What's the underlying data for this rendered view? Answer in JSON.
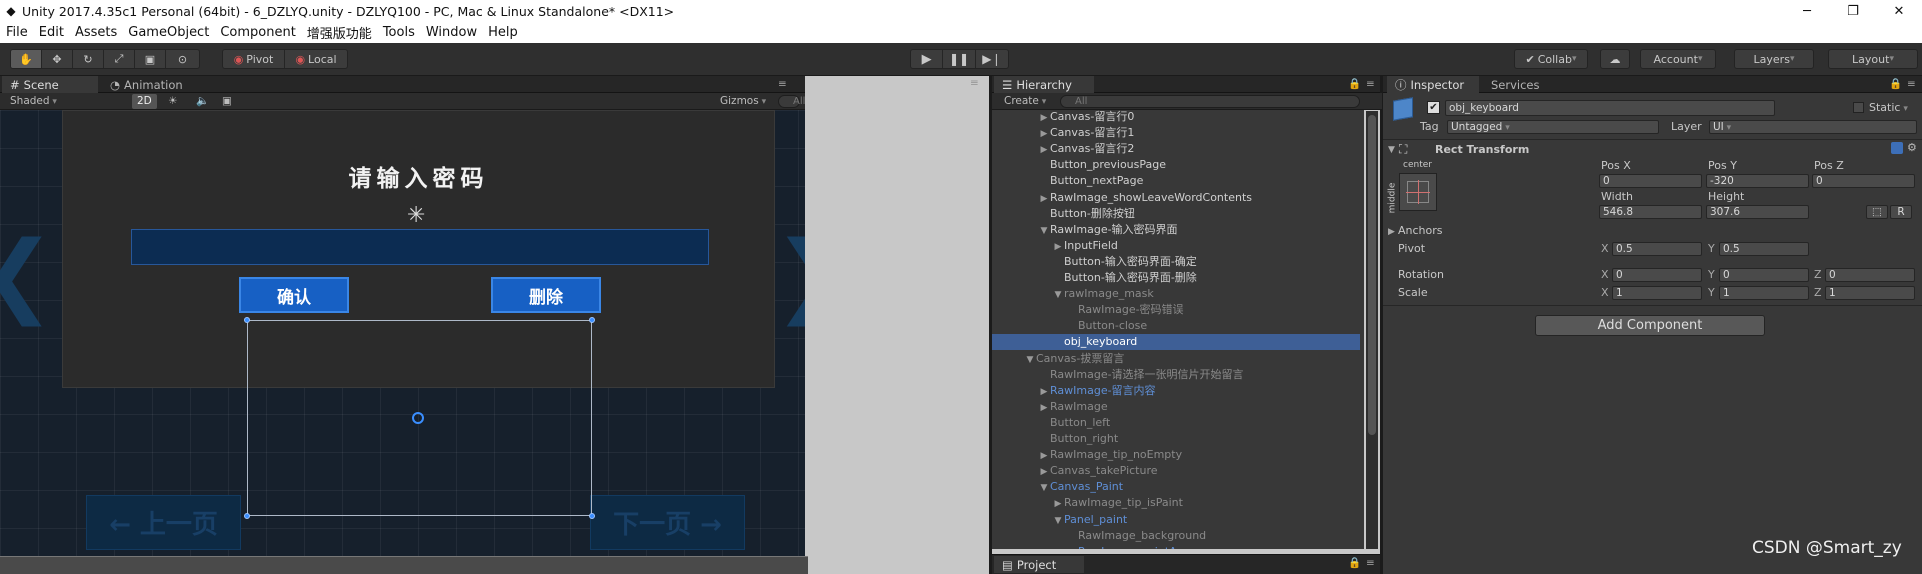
{
  "window": {
    "title": "Unity 2017.4.35c1 Personal (64bit) - 6_DZLYQ.unity - DZLYQ100 - PC, Mac & Linux Standalone* <DX11>",
    "controls": {
      "minimize": "─",
      "restore": "❐",
      "close": "✕"
    }
  },
  "menu": [
    "File",
    "Edit",
    "Assets",
    "GameObject",
    "Component",
    "增强版功能",
    "Tools",
    "Window",
    "Help"
  ],
  "toolbar": {
    "tools": [
      "hand-tool",
      "move-tool",
      "rotate-tool",
      "scale-tool",
      "rect-tool",
      "transform-tool"
    ],
    "pivot": "Pivot",
    "local": "Local",
    "collab": "Collab",
    "account": "Account",
    "layers": "Layers",
    "layout": "Layout"
  },
  "scene": {
    "tabs": [
      "Scene",
      "Animation"
    ],
    "shaded": "Shaded",
    "mode_2d": "2D",
    "gizmos": "Gizmos",
    "search_placeholder": "All",
    "pwd_title": "请输入密码",
    "confirm": "确认",
    "delete": "删除",
    "prev": "← 上一页",
    "next": "下一页 →"
  },
  "hierarchy": {
    "tab": "Hierarchy",
    "create": "Create",
    "search_placeholder": "All",
    "items": [
      {
        "label": "Canvas-留言行0",
        "indent": 1,
        "arrow": "▶",
        "style": ""
      },
      {
        "label": "Canvas-留言行1",
        "indent": 1,
        "arrow": "▶",
        "style": ""
      },
      {
        "label": "Canvas-留言行2",
        "indent": 1,
        "arrow": "▶",
        "style": ""
      },
      {
        "label": "Button_previousPage",
        "indent": 1,
        "arrow": "",
        "style": ""
      },
      {
        "label": "Button_nextPage",
        "indent": 1,
        "arrow": "",
        "style": ""
      },
      {
        "label": "RawImage_showLeaveWordContents",
        "indent": 1,
        "arrow": "▶",
        "style": ""
      },
      {
        "label": "Button-删除按钮",
        "indent": 1,
        "arrow": "",
        "style": ""
      },
      {
        "label": "RawImage-输入密码界面",
        "indent": 1,
        "arrow": "▼",
        "style": ""
      },
      {
        "label": "InputField",
        "indent": 2,
        "arrow": "▶",
        "style": ""
      },
      {
        "label": "Button-输入密码界面-确定",
        "indent": 2,
        "arrow": "",
        "style": ""
      },
      {
        "label": "Button-输入密码界面-删除",
        "indent": 2,
        "arrow": "",
        "style": ""
      },
      {
        "label": "rawImage_mask",
        "indent": 2,
        "arrow": "▼",
        "style": "dim"
      },
      {
        "label": "RawImage-密码错误",
        "indent": 3,
        "arrow": "",
        "style": "dim"
      },
      {
        "label": "Button-close",
        "indent": 3,
        "arrow": "",
        "style": "dim"
      },
      {
        "label": "obj_keyboard",
        "indent": 2,
        "arrow": "",
        "style": "sel"
      },
      {
        "label": "Canvas-拔票留言",
        "indent": 0,
        "arrow": "▼",
        "style": "dim"
      },
      {
        "label": "RawImage-请选择一张明信片开始留言",
        "indent": 1,
        "arrow": "",
        "style": "dim"
      },
      {
        "label": "RawImage-留言内容",
        "indent": 1,
        "arrow": "▶",
        "style": "blue"
      },
      {
        "label": "RawImage",
        "indent": 1,
        "arrow": "▶",
        "style": "dim"
      },
      {
        "label": "Button_left",
        "indent": 1,
        "arrow": "",
        "style": "dim"
      },
      {
        "label": "Button_right",
        "indent": 1,
        "arrow": "",
        "style": "dim"
      },
      {
        "label": "RawImage_tip_noEmpty",
        "indent": 1,
        "arrow": "▶",
        "style": "dim"
      },
      {
        "label": "Canvas_takePicture",
        "indent": 1,
        "arrow": "▶",
        "style": "dim"
      },
      {
        "label": "Canvas_Paint",
        "indent": 1,
        "arrow": "▼",
        "style": "blue"
      },
      {
        "label": "RawImage_tip_isPaint",
        "indent": 2,
        "arrow": "▶",
        "style": "dim"
      },
      {
        "label": "Panel_paint",
        "indent": 2,
        "arrow": "▼",
        "style": "blue"
      },
      {
        "label": "RawImage_background",
        "indent": 3,
        "arrow": "",
        "style": "dim"
      },
      {
        "label": "RawImage_paintArea",
        "indent": 3,
        "arrow": "",
        "style": "blue"
      }
    ]
  },
  "project": {
    "tab": "Project"
  },
  "inspector": {
    "tabs": [
      "Inspector",
      "Services"
    ],
    "object_name": "obj_keyboard",
    "static": "Static",
    "tag_label": "Tag",
    "tag_value": "Untagged",
    "layer_label": "Layer",
    "layer_value": "UI",
    "component": "Rect Transform",
    "anchor_h": "center",
    "anchor_v": "middle",
    "pos_x_label": "Pos X",
    "pos_y_label": "Pos Y",
    "pos_z_label": "Pos Z",
    "pos_x": "0",
    "pos_y": "-320",
    "pos_z": "0",
    "width_label": "Width",
    "height_label": "Height",
    "width": "546.8",
    "height": "307.6",
    "raw_btn": "R",
    "anchors": "Anchors",
    "pivot_label": "Pivot",
    "pivot_x": "0.5",
    "pivot_y": "0.5",
    "rotation_label": "Rotation",
    "rot_x": "0",
    "rot_y": "0",
    "rot_z": "0",
    "scale_label": "Scale",
    "scale_x": "1",
    "scale_y": "1",
    "scale_z": "1",
    "x": "X",
    "y": "Y",
    "z": "Z",
    "add_component": "Add Component"
  },
  "watermark": "CSDN @Smart_zy"
}
